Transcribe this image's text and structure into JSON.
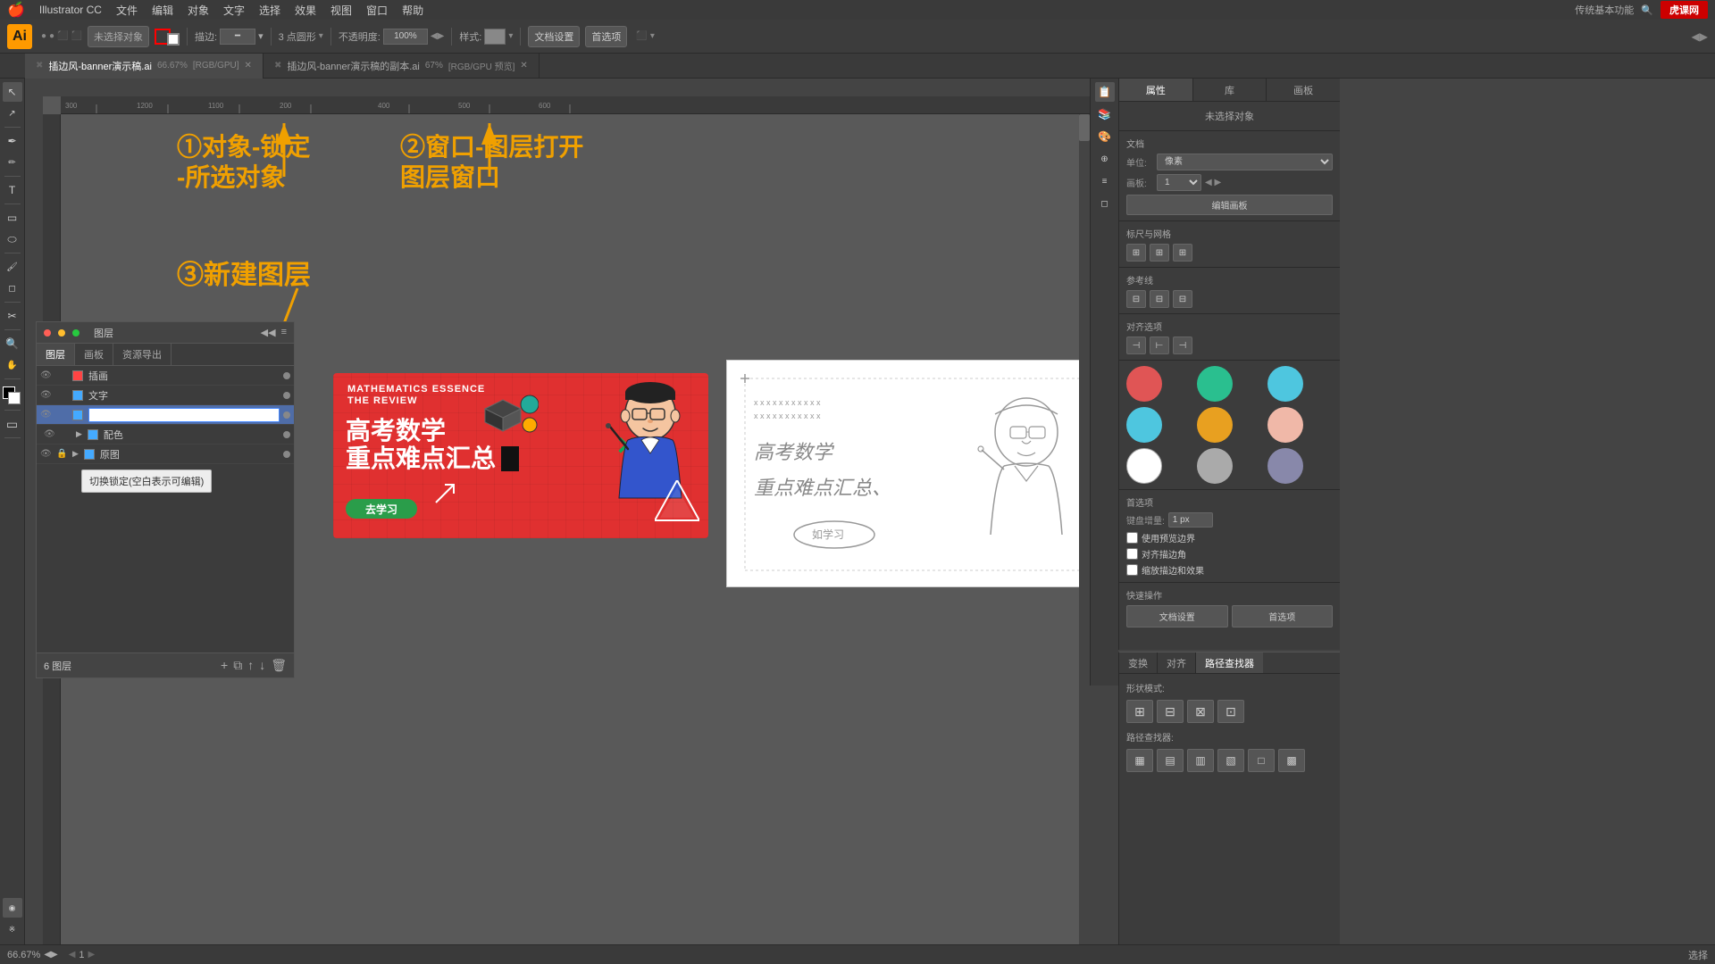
{
  "app": {
    "title": "Illustrator CC",
    "logo_text": "Ai"
  },
  "menu": {
    "apple": "🍎",
    "items": [
      "Illustrator CC",
      "文件",
      "编辑",
      "对象",
      "文字",
      "选择",
      "效果",
      "视图",
      "窗口",
      "帮助"
    ]
  },
  "toolbar": {
    "no_selection": "未选择对象",
    "stroke_label": "描边:",
    "shape_label": "3 点圆形",
    "opacity_label": "不透明度:",
    "opacity_value": "100%",
    "style_label": "样式:",
    "doc_settings": "文档设置",
    "preferences": "首选项"
  },
  "tabs": [
    {
      "name": "插边风-banner演示稿.ai",
      "zoom": "66.67%",
      "mode": "RGB/GPU",
      "active": true
    },
    {
      "name": "插边风-banner演示稿的副本.ai",
      "zoom": "67%",
      "mode": "RGB/GPU 预览",
      "active": false
    }
  ],
  "annotations": {
    "step1": "①对象-锁定",
    "step1b": "-所选对象",
    "step2": "②窗口-图层打开",
    "step2b": "图层窗口",
    "step3": "③新建图层"
  },
  "layers_panel": {
    "title": "图层",
    "tabs": [
      "图层",
      "画板",
      "资源导出"
    ],
    "layers": [
      {
        "name": "插画",
        "color": "#ff4444",
        "visible": true,
        "locked": false,
        "expanded": false
      },
      {
        "name": "文字",
        "color": "#44aaff",
        "visible": true,
        "locked": false,
        "expanded": false
      },
      {
        "name": "",
        "color": "#44aaff",
        "visible": true,
        "locked": false,
        "expanded": false,
        "editing": true
      },
      {
        "name": "配色",
        "color": "#44aaff",
        "visible": true,
        "locked": false,
        "expanded": true,
        "sub": true
      },
      {
        "name": "原图",
        "color": "#44aaff",
        "visible": true,
        "locked": true,
        "expanded": false
      }
    ],
    "footer_count": "6 图层",
    "tooltip": "切换锁定(空白表示可编辑)"
  },
  "properties_panel": {
    "title": "属性",
    "tabs": [
      "属性",
      "库",
      "画板"
    ],
    "no_selection": "未选择对象",
    "doc_section": "文档",
    "unit_label": "单位:",
    "unit_value": "像素",
    "artboard_label": "画板:",
    "artboard_value": "1",
    "edit_artboard_btn": "编辑画板",
    "align_section": "标尺与网格",
    "guides_section": "参考线",
    "align_to_section": "对齐选项",
    "preferences_section": "首选项",
    "keyboard_increment_label": "键盘增量:",
    "keyboard_increment_value": "1 px",
    "use_preview_bounds": "使用预览边界",
    "align_corners": "对齐描边角",
    "scale_strokes": "缩放描边和效果",
    "quick_actions": "快速操作",
    "doc_settings_btn": "文档设置",
    "preferences_btn": "首选项"
  },
  "color_swatches": [
    "#e05555",
    "#2abf8f",
    "#4ec6df",
    "#4ec6df",
    "#e8a020",
    "#f0b8a8",
    "#ffffff",
    "#aaaaaa",
    "#8888aa"
  ],
  "path_finder": {
    "title": "路径查找器",
    "shape_modes_label": "形状模式:",
    "path_finder_label": "路径查找器:"
  },
  "status_bar": {
    "zoom": "66.67%",
    "page": "1",
    "tool": "选择"
  },
  "tiger_logo": "虎课网",
  "tools": [
    "↖",
    "↔",
    "✏",
    "🖊",
    "T",
    "◻",
    "⭕",
    "✂",
    "🪣",
    "💧",
    "🔍",
    "⬛"
  ]
}
